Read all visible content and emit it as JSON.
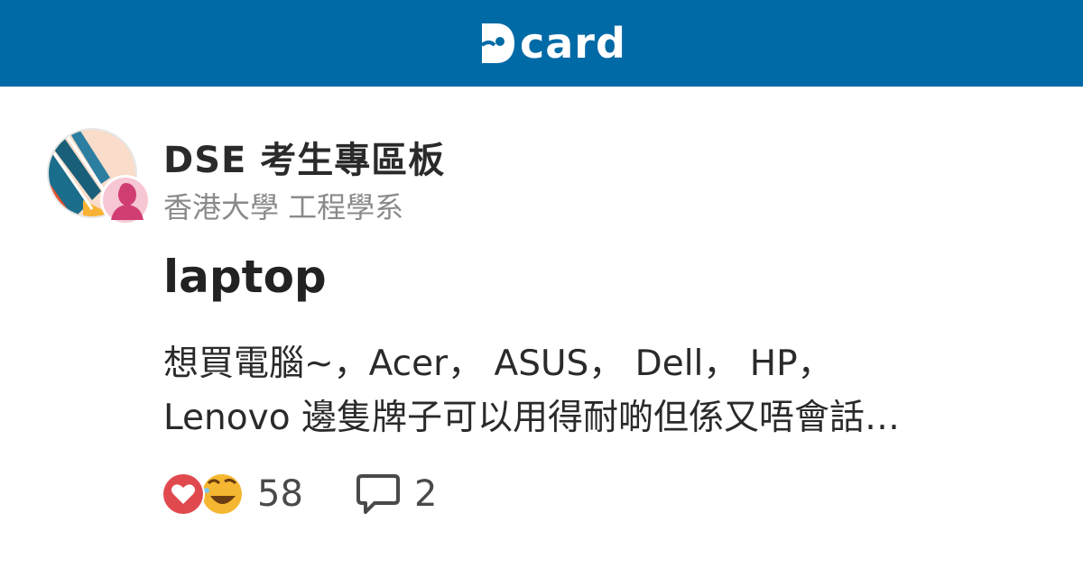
{
  "header": {
    "logo_text": "card",
    "bg_color": "#006aa6"
  },
  "post": {
    "forum": "DSE 考生專區板",
    "author_school": "香港大學 工程學系",
    "title": "laptop",
    "excerpt_lines": [
      "想買電腦~，Acer， ASUS， Dell， HP，",
      "Lenovo 邊隻牌子可以用得耐啲但係又唔會話…"
    ],
    "like_count": "58",
    "comment_count": "2"
  },
  "icons": {
    "logo": "dcard-logo-icon",
    "forum_avatar": "forum-avatar-icon",
    "author_avatar": "female-avatar-icon",
    "reaction_heart": "heart-icon",
    "reaction_laugh": "laughing-emoji-icon",
    "comment": "comment-bubble-icon"
  },
  "colors": {
    "heart": "#e04a4f",
    "laugh": "#f5b731",
    "author_avatar_bg": "#f6c6d3",
    "author_avatar_fg": "#d03d72"
  }
}
